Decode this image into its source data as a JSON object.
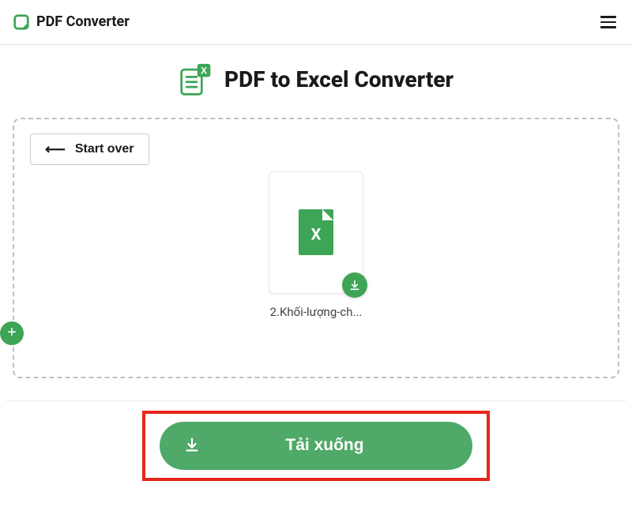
{
  "brand": {
    "name": "PDF Converter"
  },
  "page": {
    "title": "PDF to Excel Converter"
  },
  "actions": {
    "start_over": "Start over",
    "download": "Tải xuống"
  },
  "file": {
    "name": "2.Khối-lượng-ch..."
  },
  "colors": {
    "accent": "#3ea556",
    "highlight": "#e8261c"
  }
}
